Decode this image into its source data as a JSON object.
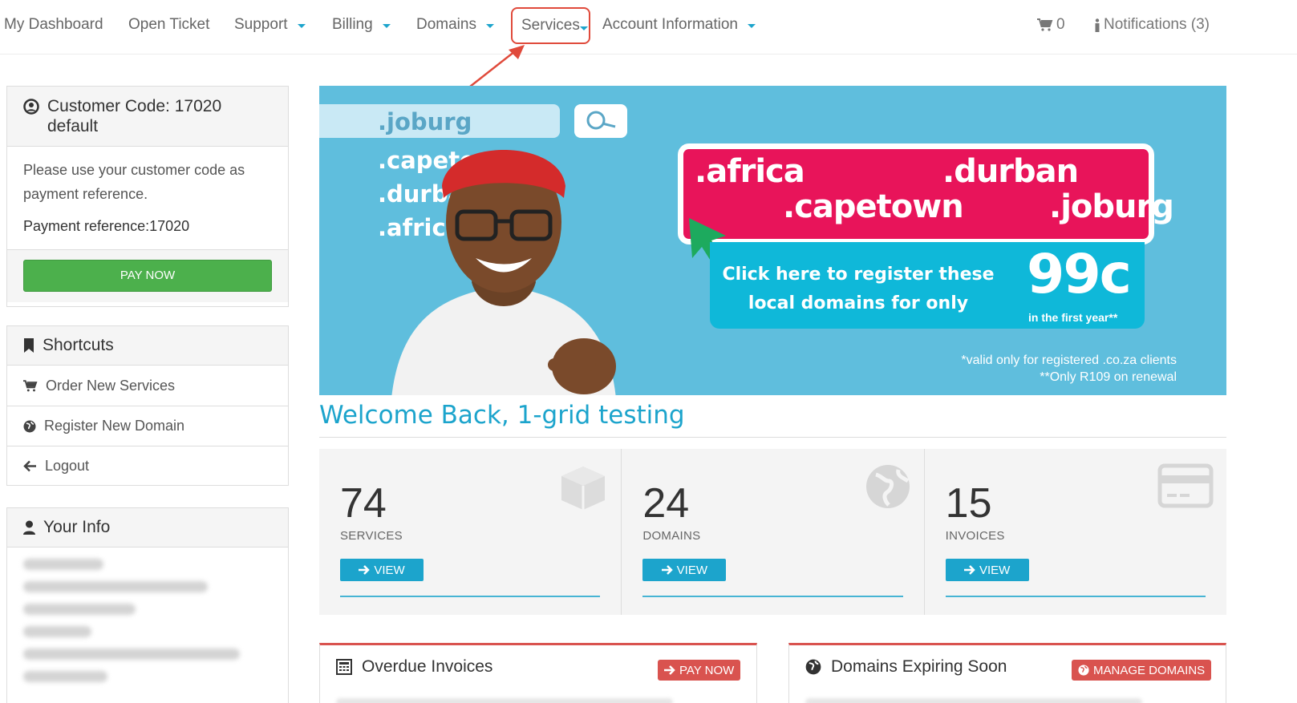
{
  "nav": {
    "items": [
      {
        "label": "My Dashboard"
      },
      {
        "label": "Open Ticket"
      },
      {
        "label": "Support"
      },
      {
        "label": "Billing"
      },
      {
        "label": "Domains"
      },
      {
        "label": "Services"
      },
      {
        "label": "Account Information"
      }
    ],
    "cart_count": "0",
    "notifications": "Notifications (3)"
  },
  "customer": {
    "title": "Customer Code: 17020 default",
    "note": "Please use your customer code as payment reference.",
    "payment_ref": "Payment reference:17020",
    "pay_now": "PAY NOW"
  },
  "shortcuts": {
    "title": "Shortcuts",
    "items": [
      {
        "label": "Order New Services"
      },
      {
        "label": "Register New Domain"
      },
      {
        "label": "Logout"
      }
    ]
  },
  "your_info": {
    "title": "Your Info"
  },
  "banner": {
    "search_domains": [
      ".joburg",
      ".capetown",
      ".durban",
      ".africa"
    ],
    "promo_domains": [
      ".africa",
      ".capetown",
      ".durban",
      ".joburg"
    ],
    "cta": "Click here to register these local domains for only",
    "price": "99c",
    "price_note": "in the first year**",
    "fine1": "*valid only for registered .co.za clients",
    "fine2": "**Only R109 on renewal"
  },
  "welcome": "Welcome Back, 1-grid testing",
  "stats": [
    {
      "value": "74",
      "label": "SERVICES",
      "button": "VIEW",
      "icon": "box-icon"
    },
    {
      "value": "24",
      "label": "DOMAINS",
      "button": "VIEW",
      "icon": "globe-icon"
    },
    {
      "value": "15",
      "label": "INVOICES",
      "button": "VIEW",
      "icon": "credit-card-icon"
    }
  ],
  "panels": {
    "overdue": {
      "title": "Overdue Invoices",
      "button": "PAY NOW"
    },
    "expiring": {
      "title": "Domains Expiring Soon",
      "button": "MANAGE DOMAINS"
    }
  },
  "colors": {
    "accent": "#1ca4cc",
    "success": "#4cb04c",
    "danger": "#d9534f",
    "highlight": "#e04a3b",
    "promo_pink": "#e8145a",
    "banner_blue": "#5fbedd"
  }
}
